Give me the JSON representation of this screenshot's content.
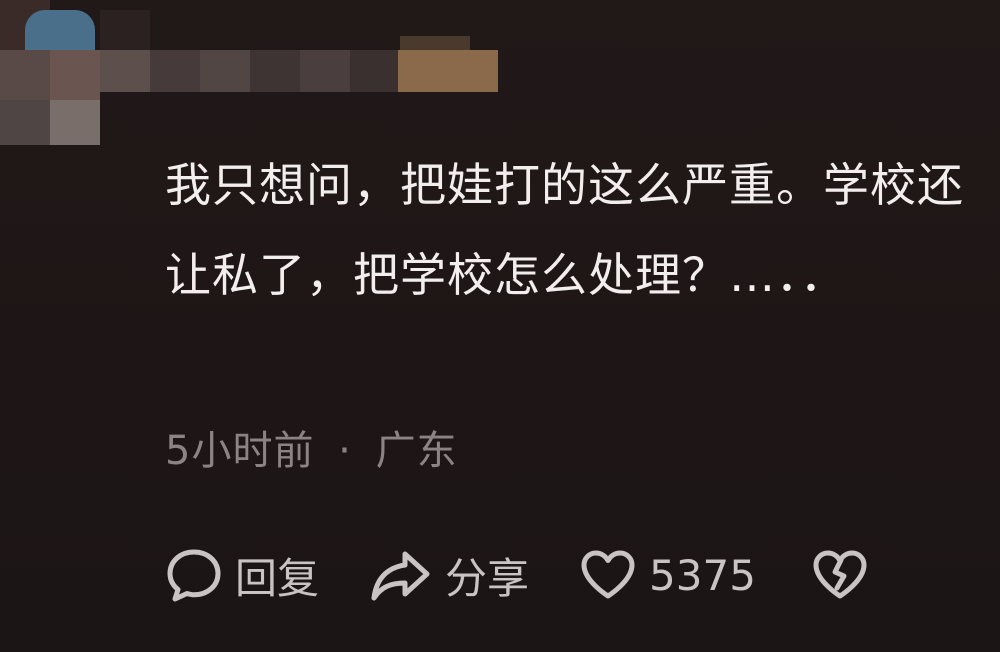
{
  "comment": {
    "text": "我只想问，把娃打的这么严重。学校还让私了，把学校怎么处理？…．．",
    "time": "5小时前",
    "separator": "·",
    "location": "广东"
  },
  "actions": {
    "reply_label": "回复",
    "share_label": "分享",
    "like_count": "5375"
  },
  "colors": {
    "background": "#1f1717",
    "text": "#f2eeee",
    "meta": "#8c8484",
    "action": "#c9c3c3"
  },
  "icons": {
    "reply": "speech-bubble-icon",
    "share": "share-arrow-icon",
    "like": "heart-icon",
    "dislike": "broken-heart-icon"
  }
}
